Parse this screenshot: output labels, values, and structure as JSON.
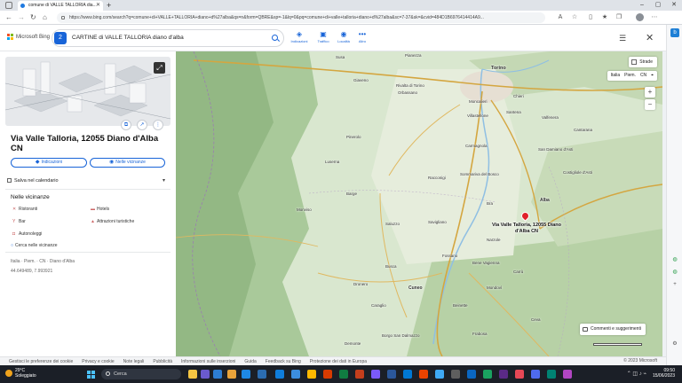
{
  "browser": {
    "tab_title": "comune di VALLE TALLORIA dia...",
    "url": "https://www.bing.com/search?q=comune+di+VALLE+TALLORIA+diano+d%27alba&qs=n&form=QBRE&sp=-1&lq=0&pq=comune+di+valle+talloria+diano+d%27alba&sc=7-37&sk=&cvid=484D1B6976414414A9..."
  },
  "bing": {
    "brand": "Microsoft Bing",
    "search_badge": "2",
    "query": "CARTINE di VALLE TALLORIA diano d'alba",
    "tools": [
      {
        "icon": "directions-icon",
        "label": "Indicazioni",
        "glyph": "◈"
      },
      {
        "icon": "traffic-icon",
        "label": "Traffico",
        "glyph": "▣"
      },
      {
        "icon": "location-icon",
        "label": "Località",
        "glyph": "◉"
      },
      {
        "icon": "more-icon",
        "label": "Altro",
        "glyph": "•••"
      }
    ]
  },
  "panel": {
    "title": "Via Valle Talloria, 12055 Diano d'Alba CN",
    "directions_label": "Indicazioni",
    "nearby_btn_label": "Nelle vicinanze",
    "calendar_label": "Salva nel calendario",
    "nearby_title": "Nelle vicinanze",
    "nearby_items": [
      "Ristoranti",
      "Hotels",
      "Bar",
      "Attrazioni turistiche",
      "Autonoleggi"
    ],
    "nearby_search": "Cerca nelle vicinanze",
    "address_line": "Italia · Piem. · CN · Diano d'Alba",
    "coords": "44.649489, 7.993921"
  },
  "map": {
    "layer_label": "Strade",
    "breadcrumb": [
      "Italia",
      "Piem.",
      "CN"
    ],
    "pin_label": "Via Valle Talloria, 12055 Diano d'Alba CN",
    "feedback": "Commenti e suggerimenti",
    "copyright": "© 2023 Microsoft",
    "places": [
      "Susa",
      "Pianezza",
      "Torino",
      "Giaveno",
      "Rivalta di Torino",
      "Moncalieri",
      "Orbassano",
      "Chieri",
      "Pinerolo",
      "Carmagnola",
      "Luserna",
      "Barge",
      "Savigliano",
      "Bra",
      "Alba",
      "Saluzzo",
      "Costigliole d'Asti",
      "Fossano",
      "Busca",
      "Cuneo",
      "Dronero",
      "Mondovì",
      "Borgo San Dalmazzo",
      "Ceva",
      "Monviso",
      "Demonte",
      "Narzole",
      "Bene Vagienna",
      "Racconigi",
      "Sommariva del Bosco",
      "Villastellone",
      "Santena",
      "Valfenera",
      "Cantarana",
      "San Damiano d'Asti",
      "Caraglio",
      "Beinette",
      "Carrù",
      "Frabosa"
    ]
  },
  "footer": {
    "links": [
      "Gestisci le preferenze dei cookie",
      "Privacy e cookie",
      "Note legali",
      "Pubblicità",
      "Informazioni sulle inserzioni",
      "Guida",
      "Feedback su Bing",
      "Protezione dei dati in Europa"
    ],
    "copyright": "© 2023 Microsoft"
  },
  "taskbar": {
    "temp": "29°C",
    "weather": "Soleggiato",
    "search": "Cerca",
    "time": "09:50",
    "date": "15/06/2023"
  }
}
